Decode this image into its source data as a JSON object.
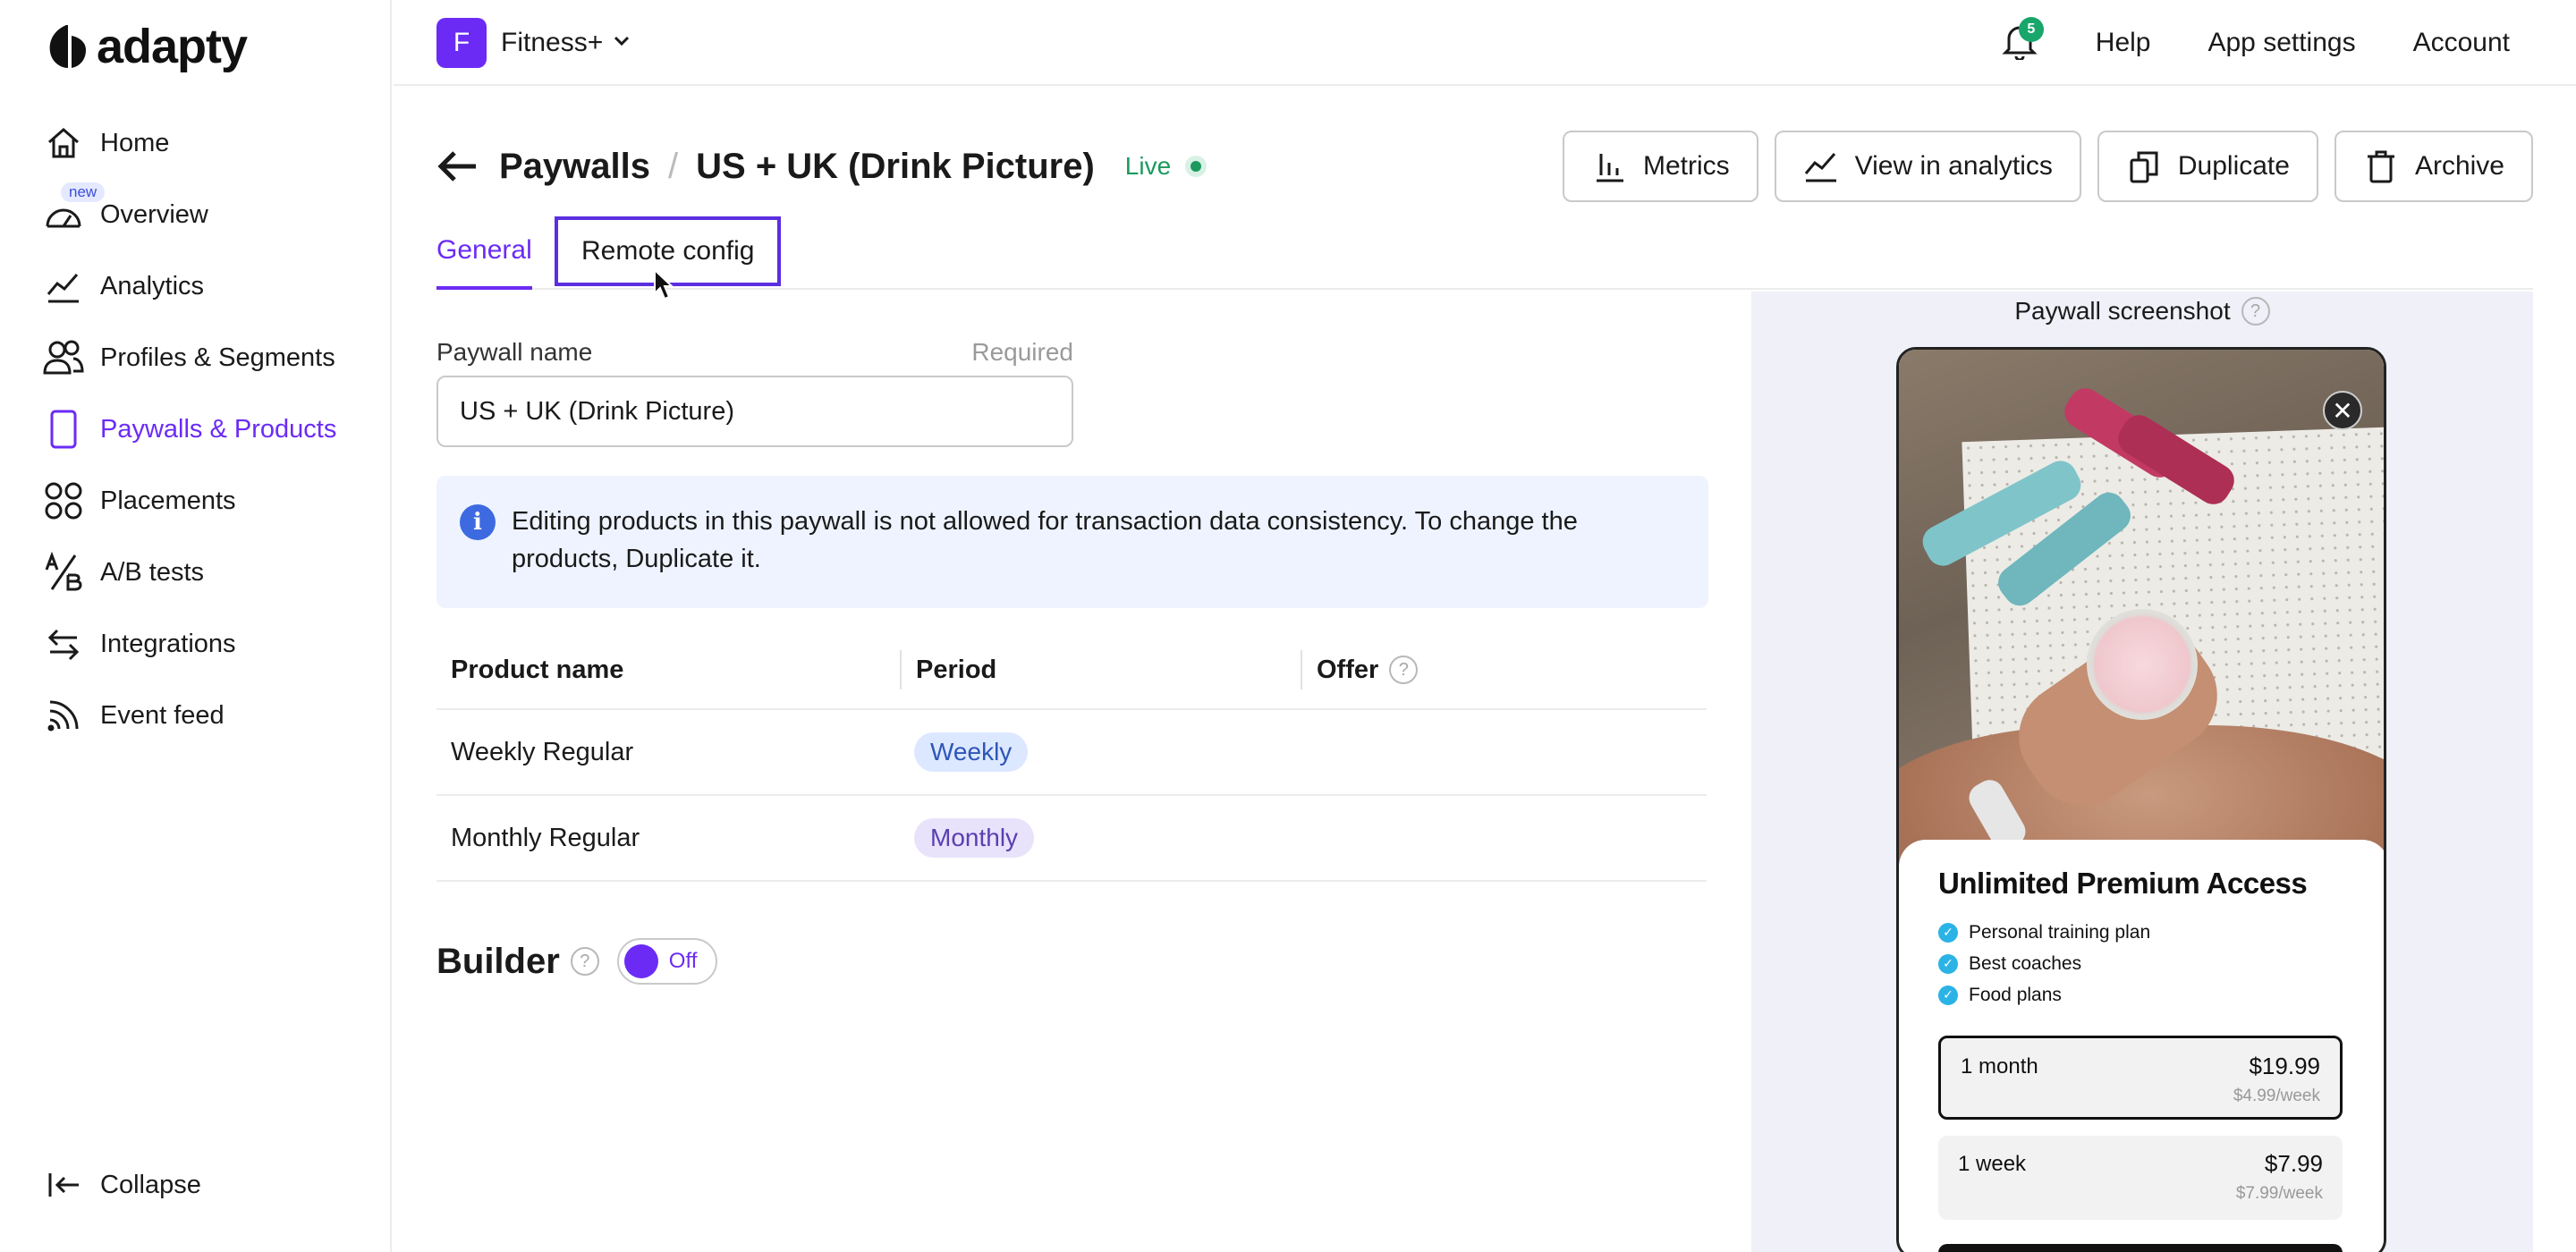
{
  "brand": {
    "logo_text": "adapty",
    "accent": "#6b2bf5"
  },
  "sidebar": {
    "items": [
      {
        "label": "Home",
        "icon": "home-icon",
        "active": false
      },
      {
        "label": "Overview",
        "icon": "gauge-icon",
        "badge": "new",
        "active": false
      },
      {
        "label": "Analytics",
        "icon": "chart-line-icon",
        "active": false
      },
      {
        "label": "Profiles & Segments",
        "icon": "users-icon",
        "active": false
      },
      {
        "label": "Paywalls & Products",
        "icon": "phone-icon",
        "active": true
      },
      {
        "label": "Placements",
        "icon": "grid-icon",
        "active": false
      },
      {
        "label": "A/B tests",
        "icon": "ab-test-icon",
        "active": false
      },
      {
        "label": "Integrations",
        "icon": "arrows-icon",
        "active": false
      },
      {
        "label": "Event feed",
        "icon": "feed-icon",
        "active": false
      }
    ],
    "collapse_label": "Collapse"
  },
  "topbar": {
    "app_initial": "F",
    "app_name": "Fitness+",
    "notification_count": "5",
    "links": {
      "help": "Help",
      "app_settings": "App settings",
      "account": "Account"
    }
  },
  "header": {
    "breadcrumb_root": "Paywalls",
    "separator": "/",
    "title": "US + UK (Drink Picture)",
    "status": "Live",
    "status_color": "#1c9a5e"
  },
  "actions": {
    "metrics": "Metrics",
    "view_in_analytics": "View in analytics",
    "duplicate": "Duplicate",
    "archive": "Archive"
  },
  "tabs": {
    "general": "General",
    "remote_config": "Remote config"
  },
  "form": {
    "name_label": "Paywall name",
    "required": "Required",
    "name_value": "US + UK (Drink Picture)"
  },
  "info": {
    "icon": "i",
    "text": "Editing products in this paywall is not allowed for transaction data consistency. To change the products, Duplicate it."
  },
  "table": {
    "headers": {
      "product_name": "Product name",
      "period": "Period",
      "offer": "Offer"
    },
    "rows": [
      {
        "name": "Weekly Regular",
        "period": "Weekly"
      },
      {
        "name": "Monthly Regular",
        "period": "Monthly"
      }
    ]
  },
  "builder": {
    "title": "Builder",
    "toggle_label": "Off"
  },
  "help_glyph": "?",
  "preview": {
    "title": "Paywall screenshot",
    "close_glyph": "✕",
    "paywall": {
      "headline": "Unlimited Premium Access",
      "features": [
        "Personal training plan",
        "Best coaches",
        "Food plans"
      ],
      "plans": [
        {
          "name": "1 month",
          "price": "$19.99",
          "sub": "$4.99/week",
          "selected": true
        },
        {
          "name": "1 week",
          "price": "$7.99",
          "sub": "$7.99/week",
          "selected": false
        }
      ]
    }
  }
}
